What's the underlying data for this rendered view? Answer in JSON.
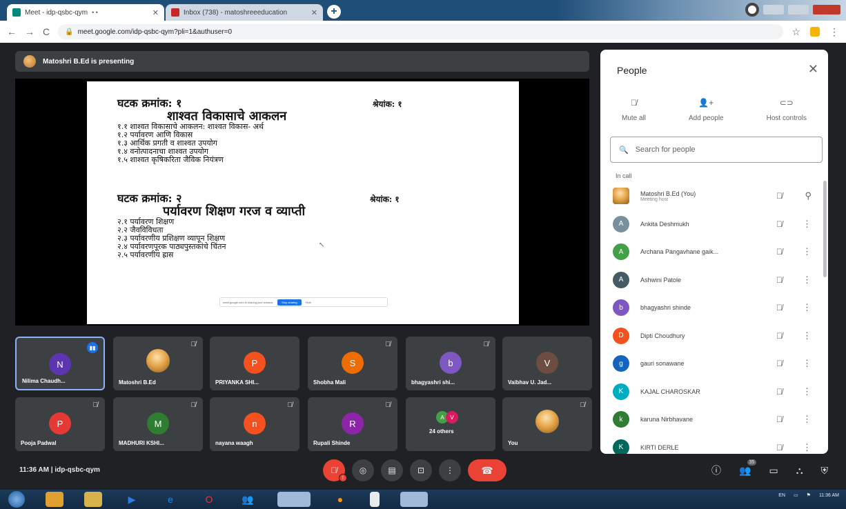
{
  "browser": {
    "tabs": [
      {
        "label": "Meet - idp-qsbc-qym",
        "extra": "• •"
      },
      {
        "label": "Inbox (738) - matoshreeeducation"
      }
    ],
    "new_tab": "+",
    "url": "meet.google.com/idp-qsbc-qym?pli=1&authuser=0"
  },
  "presenter": {
    "label": "Matoshri B.Ed is presenting"
  },
  "slide": {
    "unit1_title": "घटक क्रमांक: १",
    "unit1_marks": "श्रेयांक: १",
    "unit1_subtitle": "शाश्वत विकासाचे आकलन",
    "unit1_items": [
      "१.१ शाश्वत विकासाचे आकलन: शाश्वत विकास- अर्थ",
      "१.२ पर्यावरण आणि विकास",
      "१.३ आर्थिक प्रगती व शाश्वत उपयोग",
      "१.४ वनोत्पादनाचा शाश्वत उपयोग",
      "१.५ शाश्वत कृषिकरिता जैविक नियंत्रण"
    ],
    "unit2_title": "घटक क्रमांक: २",
    "unit2_marks": "श्रेयांक: १",
    "unit2_subtitle": "पर्यावरण शिक्षण गरज व व्याप्ती",
    "unit2_items": [
      "२.१ पर्यावरण शिक्षण",
      "२.२ जैवविविधता",
      "२.३ पर्यावरणीय प्रशिक्षण व्यापून शिक्षण",
      "२.४ पर्यावरणपूरक  पाठ्यपुस्तकांचे चिंतन",
      "२.५ पर्यावरणीय ह्रास"
    ],
    "share_notice": "meet.google.com is sharing your window.",
    "stop_sharing": "Stop sharing",
    "hide": "Hide"
  },
  "tiles": [
    {
      "name": "Nilima Chaudh...",
      "initial": "N",
      "color": "#5e35b1",
      "speaking": true
    },
    {
      "name": "Matoshri B.Ed",
      "photo": true
    },
    {
      "name": "PRIYANKA SHI...",
      "initial": "P",
      "color": "#f4511e"
    },
    {
      "name": "Shobha Mali",
      "initial": "S",
      "color": "#ef6c00"
    },
    {
      "name": "bhagyashri shi...",
      "initial": "b",
      "color": "#7e57c2"
    },
    {
      "name": "Vaibhav U. Jad...",
      "initial": "V",
      "color": "#6d4c41"
    },
    {
      "name": "Pooja Padwal",
      "initial": "P",
      "color": "#e53935"
    },
    {
      "name": "MADHURI KSHI...",
      "initial": "M",
      "color": "#2e7d32"
    },
    {
      "name": "nayana waagh",
      "initial": "n",
      "color": "#f4511e"
    },
    {
      "name": "Rupali Shinde",
      "initial": "R",
      "color": "#8e24aa"
    },
    {
      "name": "24 others",
      "others": true
    },
    {
      "name": "You",
      "photo": true
    }
  ],
  "people_panel": {
    "title": "People",
    "close": "✕",
    "actions": {
      "mute_all": "Mute all",
      "add_people": "Add people",
      "host_controls": "Host controls"
    },
    "search_placeholder": "Search for people",
    "section": "In call",
    "list": [
      {
        "name": "Matoshri B.Ed (You)",
        "role": "Meeting host",
        "photo": true
      },
      {
        "name": "Ankita Deshmukh",
        "initial": "A",
        "color": "#78909c"
      },
      {
        "name": "Archana Pangavhane gaik...",
        "initial": "A",
        "color": "#43a047"
      },
      {
        "name": "Ashwini Patole",
        "initial": "A",
        "color": "#455a64"
      },
      {
        "name": "bhagyashri shinde",
        "initial": "b",
        "color": "#7e57c2"
      },
      {
        "name": "Dipti Choudhury",
        "initial": "D",
        "color": "#f4511e"
      },
      {
        "name": "gauri sonawane",
        "initial": "g",
        "color": "#1565c0"
      },
      {
        "name": "KAJAL CHAROSKAR",
        "initial": "K",
        "color": "#00acc1"
      },
      {
        "name": "karuna Nirbhavane",
        "initial": "k",
        "color": "#2e7d32"
      },
      {
        "name": "KIRTI DERLE",
        "initial": "K",
        "color": "#00695c"
      }
    ]
  },
  "bottom": {
    "time": "11:36 AM",
    "separator": "|",
    "meeting_code": "idp-qsbc-qym",
    "people_count": "35"
  },
  "taskbar": {
    "clock": "11:36 AM",
    "lang": "EN"
  }
}
